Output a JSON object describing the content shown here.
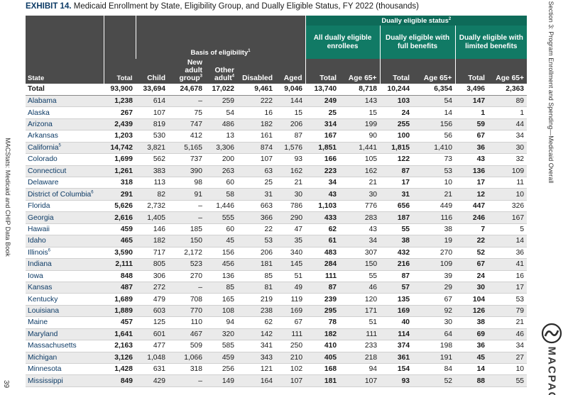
{
  "margin": {
    "left_text": "MACStats: Medicaid and CHIP Data Book",
    "page_number": "39",
    "right_text": "Section 3: Program Enrollment and Spending—Medicaid Overall",
    "logo_text": "MACPAC"
  },
  "exhibit": {
    "label": "EXHIBIT 14.",
    "title": "Medicaid Enrollment by State, Eligibility Group, and Dually Eligible Status, FY 2022 (thousands)"
  },
  "headers": {
    "dual_status": "Dually eligible status",
    "dual_status_sup": "2",
    "basis": "Basis of eligibility",
    "basis_sup": "1",
    "all_dual": "All dually eligible enrollees",
    "full_benefits": "Dually eligible with full benefits",
    "limited_benefits": "Dually eligible with limited benefits",
    "state": "State",
    "total": "Total",
    "child": "Child",
    "new_adult": "New adult group",
    "new_adult_sup": "3",
    "other_adult": "Other adult",
    "other_adult_sup": "4",
    "disabled": "Disabled",
    "aged": "Aged",
    "d_total": "Total",
    "d_65": "Age 65+",
    "f_total": "Total",
    "f_65": "Age 65+",
    "l_total": "Total",
    "l_65": "Age 65+"
  },
  "rows": [
    {
      "state": "Total",
      "sup": "",
      "total": "93,900",
      "child": "33,694",
      "new_adult": "24,678",
      "other_adult": "17,022",
      "disabled": "9,461",
      "aged": "9,046",
      "d_total": "13,740",
      "d_65": "8,718",
      "f_total": "10,244",
      "f_65": "6,354",
      "l_total": "3,496",
      "l_65": "2,363"
    },
    {
      "state": "Alabama",
      "sup": "",
      "total": "1,238",
      "child": "614",
      "new_adult": "–",
      "other_adult": "259",
      "disabled": "222",
      "aged": "144",
      "d_total": "249",
      "d_65": "143",
      "f_total": "103",
      "f_65": "54",
      "l_total": "147",
      "l_65": "89"
    },
    {
      "state": "Alaska",
      "sup": "",
      "total": "267",
      "child": "107",
      "new_adult": "75",
      "other_adult": "54",
      "disabled": "16",
      "aged": "15",
      "d_total": "25",
      "d_65": "15",
      "f_total": "24",
      "f_65": "14",
      "l_total": "1",
      "l_65": "1"
    },
    {
      "state": "Arizona",
      "sup": "",
      "total": "2,439",
      "child": "819",
      "new_adult": "747",
      "other_adult": "486",
      "disabled": "182",
      "aged": "206",
      "d_total": "314",
      "d_65": "199",
      "f_total": "255",
      "f_65": "156",
      "l_total": "59",
      "l_65": "44"
    },
    {
      "state": "Arkansas",
      "sup": "",
      "total": "1,203",
      "child": "530",
      "new_adult": "412",
      "other_adult": "13",
      "disabled": "161",
      "aged": "87",
      "d_total": "167",
      "d_65": "90",
      "f_total": "100",
      "f_65": "56",
      "l_total": "67",
      "l_65": "34"
    },
    {
      "state": "California",
      "sup": "5",
      "total": "14,742",
      "child": "3,821",
      "new_adult": "5,165",
      "other_adult": "3,306",
      "disabled": "874",
      "aged": "1,576",
      "d_total": "1,851",
      "d_65": "1,441",
      "f_total": "1,815",
      "f_65": "1,410",
      "l_total": "36",
      "l_65": "30"
    },
    {
      "state": "Colorado",
      "sup": "",
      "total": "1,699",
      "child": "562",
      "new_adult": "737",
      "other_adult": "200",
      "disabled": "107",
      "aged": "93",
      "d_total": "166",
      "d_65": "105",
      "f_total": "122",
      "f_65": "73",
      "l_total": "43",
      "l_65": "32"
    },
    {
      "state": "Connecticut",
      "sup": "",
      "total": "1,261",
      "child": "383",
      "new_adult": "390",
      "other_adult": "263",
      "disabled": "63",
      "aged": "162",
      "d_total": "223",
      "d_65": "162",
      "f_total": "87",
      "f_65": "53",
      "l_total": "136",
      "l_65": "109"
    },
    {
      "state": "Delaware",
      "sup": "",
      "total": "318",
      "child": "113",
      "new_adult": "98",
      "other_adult": "60",
      "disabled": "25",
      "aged": "21",
      "d_total": "34",
      "d_65": "21",
      "f_total": "17",
      "f_65": "10",
      "l_total": "17",
      "l_65": "11"
    },
    {
      "state": "District of Columbia",
      "sup": "6",
      "total": "291",
      "child": "82",
      "new_adult": "91",
      "other_adult": "58",
      "disabled": "31",
      "aged": "30",
      "d_total": "43",
      "d_65": "30",
      "f_total": "31",
      "f_65": "21",
      "l_total": "12",
      "l_65": "10"
    },
    {
      "state": "Florida",
      "sup": "",
      "total": "5,626",
      "child": "2,732",
      "new_adult": "–",
      "other_adult": "1,446",
      "disabled": "663",
      "aged": "786",
      "d_total": "1,103",
      "d_65": "776",
      "f_total": "656",
      "f_65": "449",
      "l_total": "447",
      "l_65": "326"
    },
    {
      "state": "Georgia",
      "sup": "",
      "total": "2,616",
      "child": "1,405",
      "new_adult": "–",
      "other_adult": "555",
      "disabled": "366",
      "aged": "290",
      "d_total": "433",
      "d_65": "283",
      "f_total": "187",
      "f_65": "116",
      "l_total": "246",
      "l_65": "167"
    },
    {
      "state": "Hawaii",
      "sup": "",
      "total": "459",
      "child": "146",
      "new_adult": "185",
      "other_adult": "60",
      "disabled": "22",
      "aged": "47",
      "d_total": "62",
      "d_65": "43",
      "f_total": "55",
      "f_65": "38",
      "l_total": "7",
      "l_65": "5"
    },
    {
      "state": "Idaho",
      "sup": "",
      "total": "465",
      "child": "182",
      "new_adult": "150",
      "other_adult": "45",
      "disabled": "53",
      "aged": "35",
      "d_total": "61",
      "d_65": "34",
      "f_total": "38",
      "f_65": "19",
      "l_total": "22",
      "l_65": "14"
    },
    {
      "state": "Illinois",
      "sup": "6",
      "total": "3,590",
      "child": "717",
      "new_adult": "2,172",
      "other_adult": "156",
      "disabled": "206",
      "aged": "340",
      "d_total": "483",
      "d_65": "307",
      "f_total": "432",
      "f_65": "270",
      "l_total": "52",
      "l_65": "36"
    },
    {
      "state": "Indiana",
      "sup": "",
      "total": "2,111",
      "child": "805",
      "new_adult": "523",
      "other_adult": "456",
      "disabled": "181",
      "aged": "145",
      "d_total": "284",
      "d_65": "150",
      "f_total": "216",
      "f_65": "109",
      "l_total": "67",
      "l_65": "41"
    },
    {
      "state": "Iowa",
      "sup": "",
      "total": "848",
      "child": "306",
      "new_adult": "270",
      "other_adult": "136",
      "disabled": "85",
      "aged": "51",
      "d_total": "111",
      "d_65": "55",
      "f_total": "87",
      "f_65": "39",
      "l_total": "24",
      "l_65": "16"
    },
    {
      "state": "Kansas",
      "sup": "",
      "total": "487",
      "child": "272",
      "new_adult": "–",
      "other_adult": "85",
      "disabled": "81",
      "aged": "49",
      "d_total": "87",
      "d_65": "46",
      "f_total": "57",
      "f_65": "29",
      "l_total": "30",
      "l_65": "17"
    },
    {
      "state": "Kentucky",
      "sup": "",
      "total": "1,689",
      "child": "479",
      "new_adult": "708",
      "other_adult": "165",
      "disabled": "219",
      "aged": "119",
      "d_total": "239",
      "d_65": "120",
      "f_total": "135",
      "f_65": "67",
      "l_total": "104",
      "l_65": "53"
    },
    {
      "state": "Louisiana",
      "sup": "",
      "total": "1,889",
      "child": "603",
      "new_adult": "770",
      "other_adult": "108",
      "disabled": "238",
      "aged": "169",
      "d_total": "295",
      "d_65": "171",
      "f_total": "169",
      "f_65": "92",
      "l_total": "126",
      "l_65": "79"
    },
    {
      "state": "Maine",
      "sup": "",
      "total": "457",
      "child": "125",
      "new_adult": "110",
      "other_adult": "94",
      "disabled": "62",
      "aged": "67",
      "d_total": "78",
      "d_65": "51",
      "f_total": "40",
      "f_65": "30",
      "l_total": "38",
      "l_65": "21"
    },
    {
      "state": "Maryland",
      "sup": "",
      "total": "1,641",
      "child": "601",
      "new_adult": "467",
      "other_adult": "320",
      "disabled": "142",
      "aged": "111",
      "d_total": "182",
      "d_65": "111",
      "f_total": "114",
      "f_65": "64",
      "l_total": "69",
      "l_65": "46"
    },
    {
      "state": "Massachusetts",
      "sup": "",
      "total": "2,163",
      "child": "477",
      "new_adult": "509",
      "other_adult": "585",
      "disabled": "341",
      "aged": "250",
      "d_total": "410",
      "d_65": "233",
      "f_total": "374",
      "f_65": "198",
      "l_total": "36",
      "l_65": "34"
    },
    {
      "state": "Michigan",
      "sup": "",
      "total": "3,126",
      "child": "1,048",
      "new_adult": "1,066",
      "other_adult": "459",
      "disabled": "343",
      "aged": "210",
      "d_total": "405",
      "d_65": "218",
      "f_total": "361",
      "f_65": "191",
      "l_total": "45",
      "l_65": "27"
    },
    {
      "state": "Minnesota",
      "sup": "",
      "total": "1,428",
      "child": "631",
      "new_adult": "318",
      "other_adult": "256",
      "disabled": "121",
      "aged": "102",
      "d_total": "168",
      "d_65": "94",
      "f_total": "154",
      "f_65": "84",
      "l_total": "14",
      "l_65": "10"
    },
    {
      "state": "Mississippi",
      "sup": "",
      "total": "849",
      "child": "429",
      "new_adult": "–",
      "other_adult": "149",
      "disabled": "164",
      "aged": "107",
      "d_total": "181",
      "d_65": "107",
      "f_total": "93",
      "f_65": "52",
      "l_total": "88",
      "l_65": "55"
    }
  ],
  "colors": {
    "header_dark": "#4b4b4b",
    "header_teal": "#117a65",
    "row_shade": "#eaeaea",
    "state_text": "#0d3b66"
  }
}
